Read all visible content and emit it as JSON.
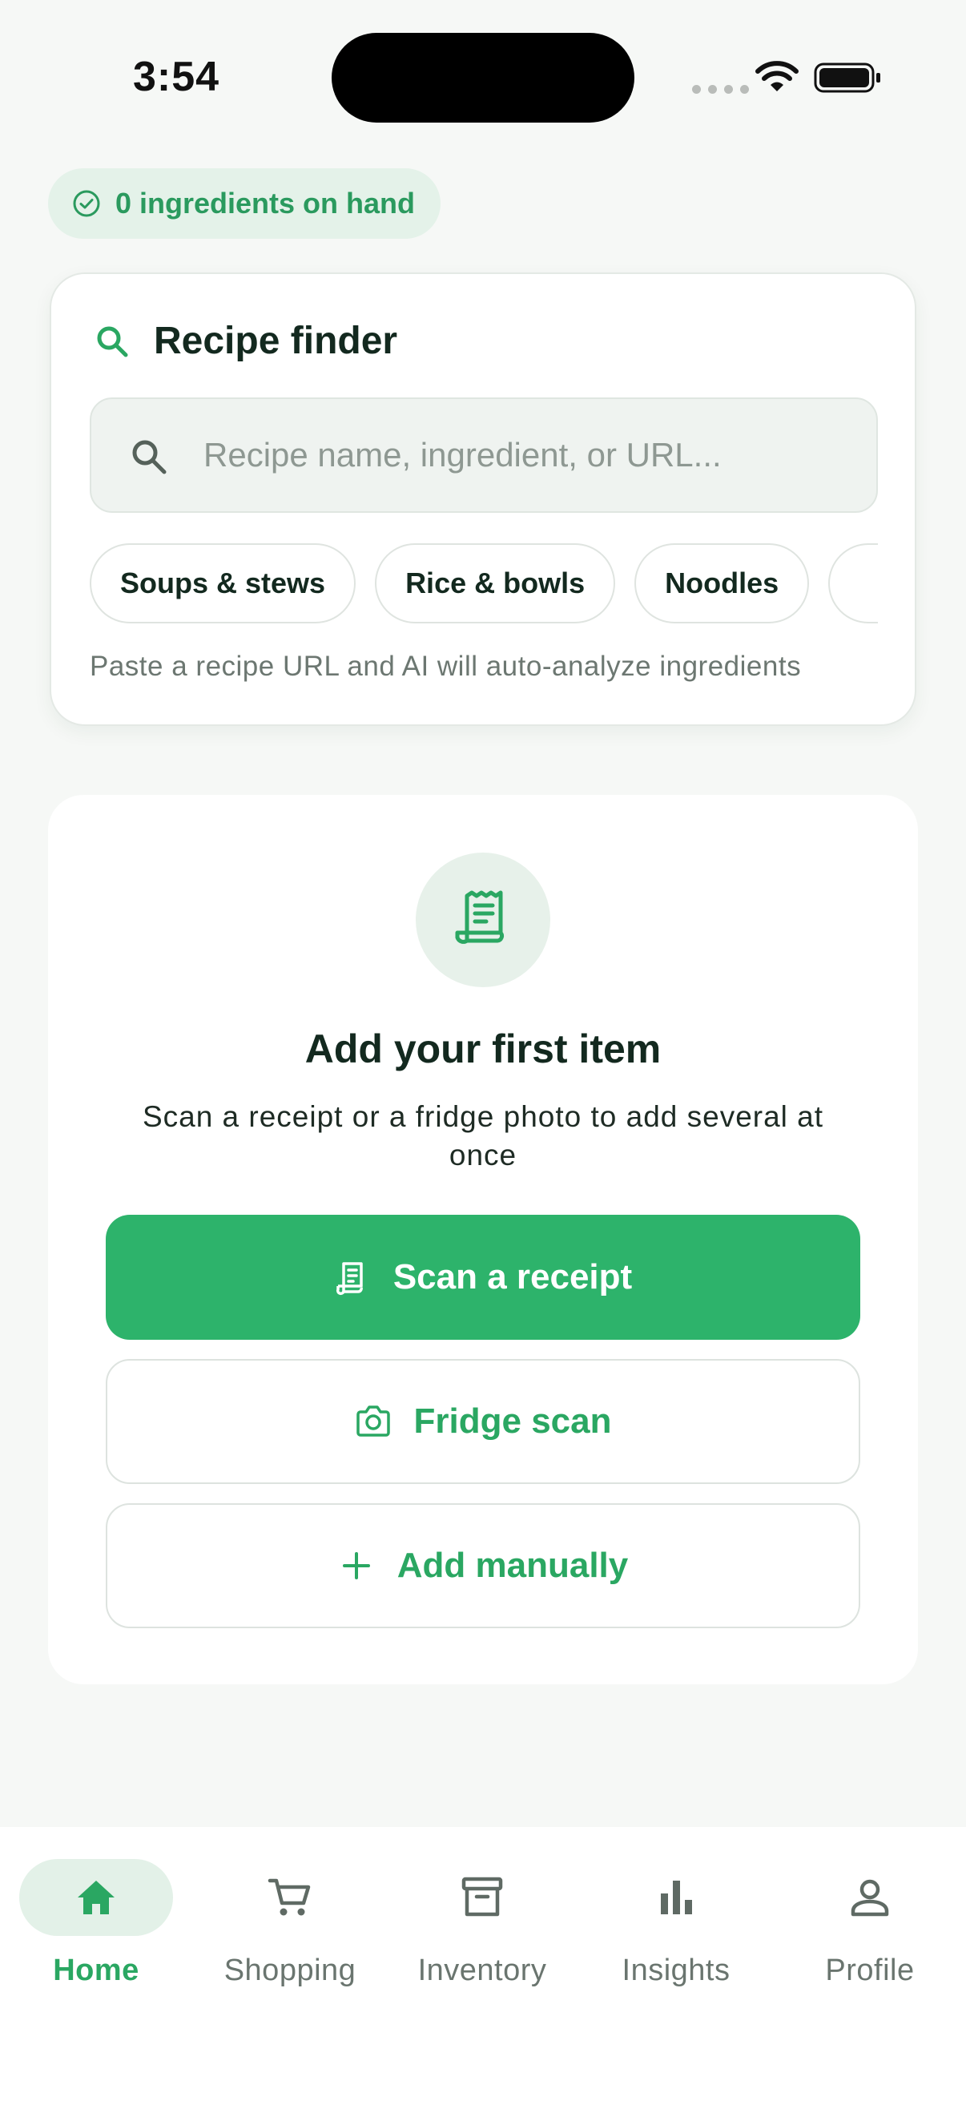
{
  "status_bar": {
    "time": "3:54"
  },
  "on_hand": {
    "label": "0 ingredients on hand"
  },
  "recipe_finder": {
    "title": "Recipe finder",
    "search_placeholder": "Recipe name, ingredient, or URL...",
    "categories": [
      "Soups & stews",
      "Rice & bowls",
      "Noodles",
      ""
    ],
    "hint": "Paste a recipe URL and AI will auto-analyze ingredients"
  },
  "empty_state": {
    "title": "Add your first item",
    "subtitle": "Scan a receipt or a fridge photo to add several at once",
    "scan_receipt_label": "Scan a receipt",
    "fridge_scan_label": "Fridge scan",
    "add_manually_label": "Add manually"
  },
  "nav": {
    "items": [
      {
        "label": "Home",
        "icon": "home-icon",
        "active": true
      },
      {
        "label": "Shopping",
        "icon": "cart-icon",
        "active": false
      },
      {
        "label": "Inventory",
        "icon": "archive-box-icon",
        "active": false
      },
      {
        "label": "Insights",
        "icon": "bar-chart-icon",
        "active": false
      },
      {
        "label": "Profile",
        "icon": "person-icon",
        "active": false
      }
    ]
  },
  "colors": {
    "accent": "#2db36b",
    "accent_text": "#2aa762",
    "background": "#f6f8f6"
  }
}
